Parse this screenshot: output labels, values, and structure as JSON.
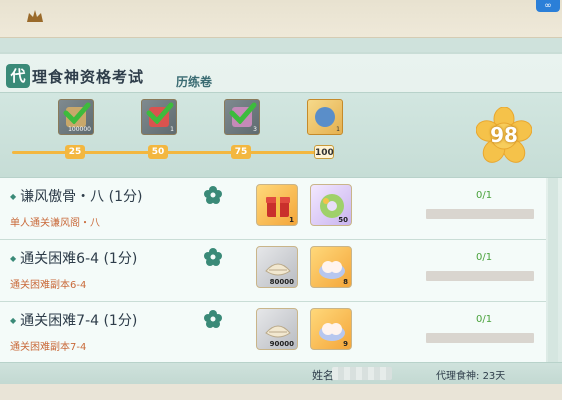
{
  "header": {
    "badge": "∞"
  },
  "title": {
    "tag": "代",
    "text": "理食神资格考试",
    "sub": "历练卷"
  },
  "progress": {
    "score": "98",
    "markers": [
      "25",
      "50",
      "75",
      "100"
    ],
    "rewards": [
      {
        "count": "100000",
        "state": "completed"
      },
      {
        "count": "1",
        "state": "completed"
      },
      {
        "count": "3",
        "state": "completed"
      },
      {
        "count": "1",
        "state": "available"
      }
    ]
  },
  "tasks": [
    {
      "title": "谦风傲骨・八 (1分)",
      "desc": "单人通关谦风阁・八",
      "items": [
        {
          "count": "1",
          "kind": "gift-box"
        },
        {
          "count": "50",
          "kind": "jade-ring"
        }
      ],
      "progress_text": "0/1",
      "progress": 0
    },
    {
      "title": "通关困难6-4 (1分)",
      "desc": "通关困难副本6-4",
      "items": [
        {
          "count": "80000",
          "kind": "coin-pouch"
        },
        {
          "count": "8",
          "kind": "bun-plate"
        }
      ],
      "progress_text": "0/1",
      "progress": 0
    },
    {
      "title": "通关困难7-4 (1分)",
      "desc": "通关困难副本7-4",
      "items": [
        {
          "count": "90000",
          "kind": "coin-pouch"
        },
        {
          "count": "9",
          "kind": "bun-plate"
        }
      ],
      "progress_text": "0/1",
      "progress": 0
    }
  ],
  "footer": {
    "name_label": "姓名",
    "agent_label": "代理食神:",
    "agent_days": "23天"
  },
  "colors": {
    "accent": "#3a8a78",
    "track": "#f3b73f",
    "progress_green": "#49a23b",
    "desc_orange": "#c96a3a"
  }
}
